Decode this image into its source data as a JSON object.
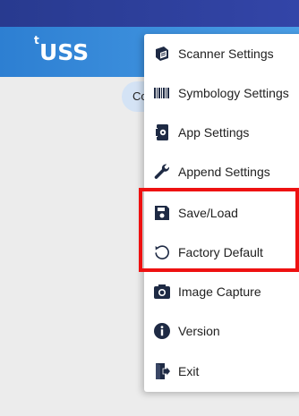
{
  "app": {
    "logo_text": "USS",
    "logo_mark": "t",
    "connect_label": "Co"
  },
  "menu": {
    "items": [
      {
        "label": "Scanner Settings",
        "icon": "scanner-icon"
      },
      {
        "label": "Symbology Settings",
        "icon": "barcode-icon"
      },
      {
        "label": "App Settings",
        "icon": "phone-settings-icon"
      },
      {
        "label": "Append Settings",
        "icon": "wrench-icon"
      },
      {
        "label": "Save/Load",
        "icon": "floppy-disk-icon"
      },
      {
        "label": "Factory Default",
        "icon": "restore-icon"
      },
      {
        "label": "Image Capture",
        "icon": "camera-icon"
      },
      {
        "label": "Version",
        "icon": "info-icon"
      },
      {
        "label": "Exit",
        "icon": "exit-icon"
      }
    ]
  },
  "colors": {
    "status_bar": "#283a8f",
    "app_bar": "#2d7fd2",
    "menu_icon": "#1e2a44",
    "highlight": "#ee1111"
  }
}
